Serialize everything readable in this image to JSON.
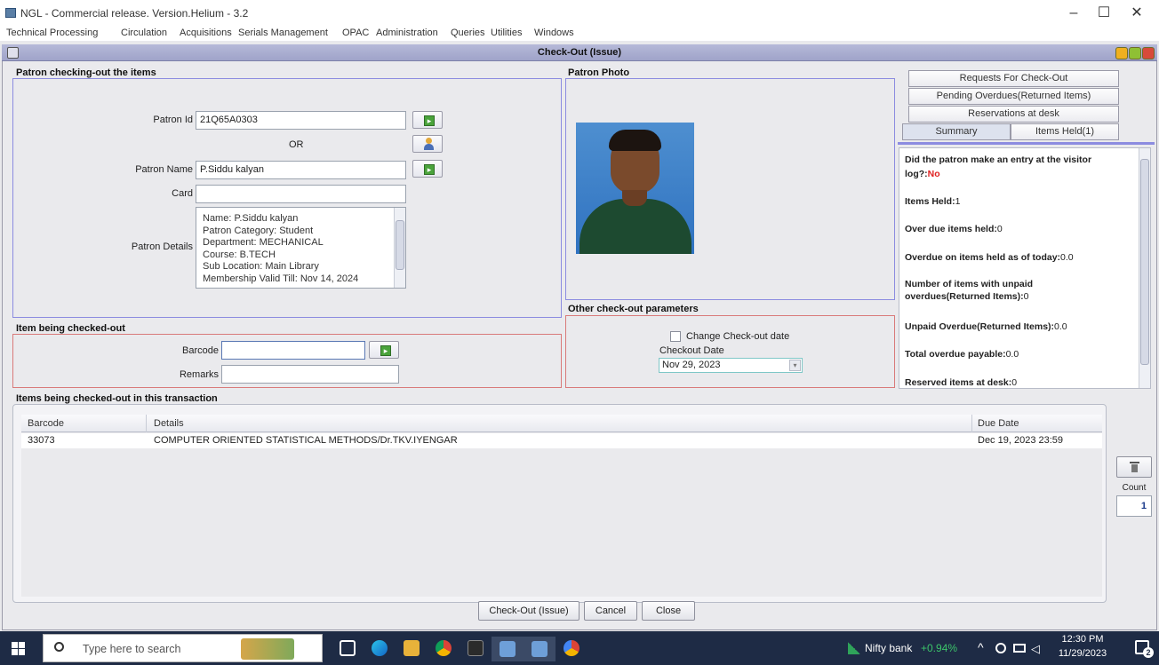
{
  "window": {
    "title": "NGL - Commercial release. Version.Helium - 3.2",
    "minimize": "–",
    "maximize": "☐",
    "close": "✕"
  },
  "menubar": [
    "Technical Processing",
    "Circulation",
    "Acquisitions",
    "Serials Management",
    "OPAC",
    "Administration",
    "Queries",
    "Utilities",
    "Windows"
  ],
  "frame": {
    "title": "Check-Out (Issue)"
  },
  "patron_section": {
    "heading": "Patron checking-out the items",
    "patron_id_label": "Patron Id",
    "patron_id_value": "21Q65A0303",
    "or_label": "OR",
    "patron_name_label": "Patron Name",
    "patron_name_value": "P.Siddu kalyan",
    "card_label": "Card",
    "card_value": "",
    "details_label": "Patron Details",
    "details_lines": [
      "Name: P.Siddu kalyan",
      "Patron Category: Student",
      "Department: MECHANICAL",
      "Course: B.TECH",
      "Sub Location: Main Library",
      "Membership Valid Till: Nov 14, 2024"
    ]
  },
  "photo_section": {
    "heading": "Patron Photo"
  },
  "item_section": {
    "heading": "Item being checked-out",
    "barcode_label": "Barcode",
    "barcode_value": "",
    "remarks_label": "Remarks",
    "remarks_value": ""
  },
  "params_section": {
    "heading": "Other check-out parameters",
    "change_date_label": "Change Check-out date",
    "change_date_checked": false,
    "checkout_date_label": "Checkout Date",
    "checkout_date_value": "Nov 29, 2023"
  },
  "right_tabs": {
    "requests": "Requests For Check-Out",
    "pending": "Pending Overdues(Returned Items)",
    "reservations": "Reservations at desk",
    "summary": "Summary",
    "items_held": "Items Held(1)"
  },
  "summary": {
    "visitor_q": "Did the patron make an entry at the visitor log?:",
    "visitor_a": "No",
    "items_held_label": "Items Held:",
    "items_held_value": "1",
    "overdue_held_label": "Over due items held:",
    "overdue_held_value": "0",
    "overdue_today_label": "Overdue on items held as of today:",
    "overdue_today_value": "0.0",
    "unpaid_count_label": "Number of items with unpaid overdues(Returned Items):",
    "unpaid_count_value": "0",
    "unpaid_overdue_label": "Unpaid Overdue(Returned Items):",
    "unpaid_overdue_value": "0.0",
    "total_payable_label": "Total overdue payable:",
    "total_payable_value": "0.0",
    "reserved_label": "Reserved items at desk:",
    "reserved_value": "0"
  },
  "transaction": {
    "heading": "Items being checked-out in this transaction",
    "columns": [
      "Barcode",
      "Details",
      "Due Date"
    ],
    "rows": [
      {
        "barcode": "33073",
        "details": "COMPUTER ORIENTED STATISTICAL METHODS/Dr.TKV.IYENGAR",
        "due": "Dec 19, 2023 23:59"
      }
    ],
    "count_label": "Count",
    "count_value": "1"
  },
  "buttons": {
    "checkout": "Check-Out (Issue)",
    "cancel": "Cancel",
    "close": "Close"
  },
  "taskbar": {
    "search_placeholder": "Type here to search",
    "nifty_label": "Nifty bank",
    "nifty_change": "+0.94%",
    "time": "12:30 PM",
    "date": "11/29/2023",
    "notif_count": "2"
  }
}
